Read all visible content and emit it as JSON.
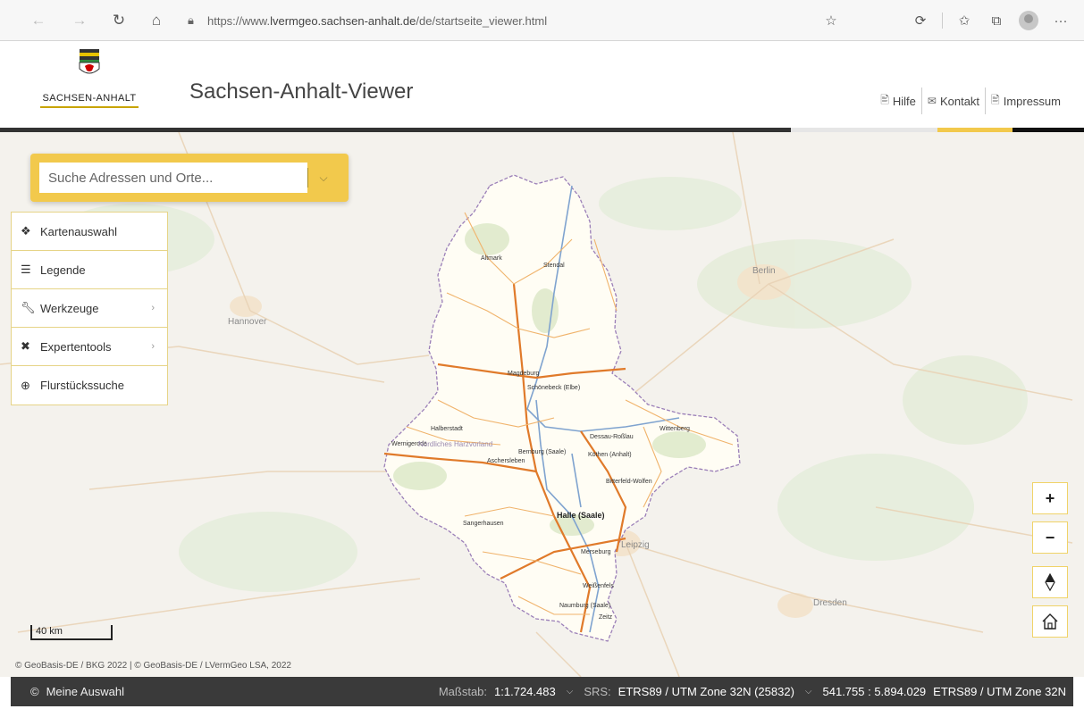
{
  "browser": {
    "url_prefix": "https://www.",
    "url_domain": "lvermgeo.sachsen-anhalt.de",
    "url_path": "/de/startseite_viewer.html"
  },
  "header": {
    "logo_text": "SACHSEN-ANHALT",
    "title": "Sachsen-Anhalt-Viewer",
    "links": {
      "help": "Hilfe",
      "contact": "Kontakt",
      "imprint": "Impressum"
    }
  },
  "colors": {
    "accent_yellow": "#f2c94c",
    "band_light": "#e6e6e6",
    "band_yellow": "#f2c94c",
    "band_black": "#111111",
    "band_dark": "#333333",
    "bottom_bar": "#3a3a3a",
    "state_fill": "#fffdf4",
    "border_purple": "#9b7fb8",
    "road_orange": "#e08b2e",
    "river_blue": "#7fa3cf"
  },
  "search": {
    "placeholder": "Suche Adressen und Orte..."
  },
  "menu": {
    "items": [
      {
        "label": "Kartenauswahl",
        "icon": "layers-icon",
        "has_submenu": false
      },
      {
        "label": "Legende",
        "icon": "list-icon",
        "has_submenu": false
      },
      {
        "label": "Werkzeuge",
        "icon": "wrench-icon",
        "has_submenu": true
      },
      {
        "label": "Expertentools",
        "icon": "tools-icon",
        "has_submenu": true
      },
      {
        "label": "Flurstückssuche",
        "icon": "search-parcel-icon",
        "has_submenu": false
      }
    ]
  },
  "map": {
    "labels": {
      "berlin": "Berlin",
      "magdeburg": "Magdeburg",
      "halle": "Halle (Saale)",
      "altmark": "Altmark",
      "stendal": "Stendal",
      "schoenebeck": "Schönebeck (Elbe)",
      "dessau": "Dessau-Roßlau",
      "wittenberg": "Wittenberg",
      "halberstadt": "Halberstadt",
      "wernigerode": "Wernigerode",
      "bernburg": "Bernburg (Saale)",
      "koethen": "Köthen (Anhalt)",
      "bitterfeld": "Bitterfeld-Wolfen",
      "sangerhausen": "Sangerhausen",
      "merseburg": "Merseburg",
      "weissenfels": "Weißenfels",
      "naumburg": "Naumburg (Saale)",
      "zeitz": "Zeitz",
      "leipzig": "Leipzig",
      "hannover": "Hannover",
      "dresden": "Dresden",
      "aschersleben": "Aschersleben",
      "nordharz": "Nördliches Harzvorland"
    },
    "controls": {
      "zoom_in": "+",
      "zoom_out": "−",
      "north": "⧫",
      "home": "⌂"
    },
    "scale_label": "40 km",
    "attribution": "© GeoBasis-DE / BKG 2022 | © GeoBasis-DE / LVermGeo LSA, 2022"
  },
  "bottom_bar": {
    "selection_label": "Meine Auswahl",
    "scale_label": "Maßstab:",
    "scale_value": "1:1.724.483",
    "srs_label": "SRS:",
    "srs_value": "ETRS89 / UTM Zone 32N (25832)",
    "coordinates": "541.755 : 5.894.029",
    "coordinates_srs": "ETRS89 / UTM Zone 32N"
  }
}
